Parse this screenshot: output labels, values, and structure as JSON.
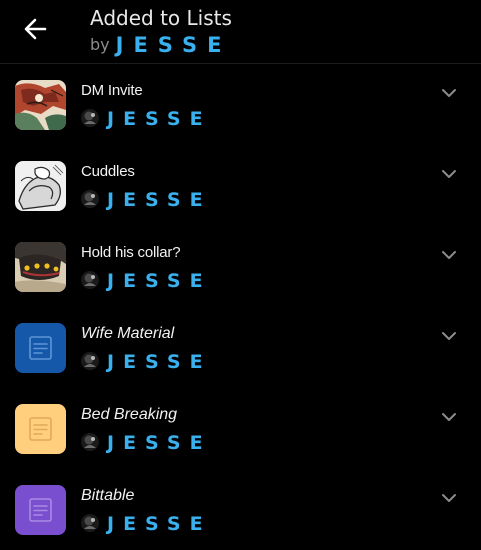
{
  "header": {
    "title": "Added to Lists",
    "by_label": "by",
    "author": "JESSE"
  },
  "colors": {
    "background": "#000000",
    "accent": "#3ab0ee",
    "muted": "#8c8c8c"
  },
  "lists": [
    {
      "name": "DM Invite",
      "owner": "JESSE",
      "thumbnail": "artwork"
    },
    {
      "name": "Cuddles",
      "owner": "JESSE",
      "thumbnail": "artwork"
    },
    {
      "name": "Hold his collar?",
      "owner": "JESSE",
      "thumbnail": "artwork"
    },
    {
      "name": "Wife Material",
      "owner": "JESSE",
      "thumbnail": "document-icon",
      "color": "#1557a8"
    },
    {
      "name": "Bed Breaking",
      "owner": "JESSE",
      "thumbnail": "document-icon",
      "color": "#ffcf7d"
    },
    {
      "name": "Bittable",
      "owner": "JESSE",
      "thumbnail": "document-icon",
      "color": "#7a4fcf"
    }
  ]
}
